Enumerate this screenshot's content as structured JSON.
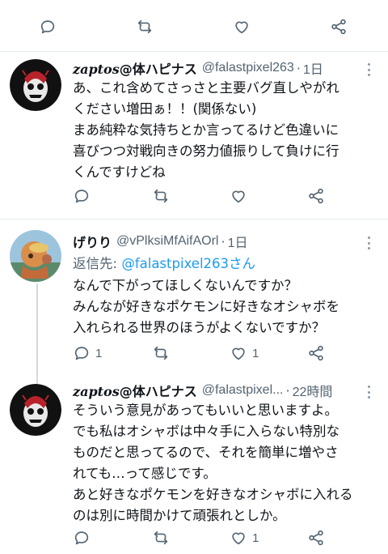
{
  "top_actions": {
    "reply_count": "",
    "retweet_count": "",
    "like_count": ""
  },
  "tweets": [
    {
      "display_name_latin": "zaptos",
      "display_name_rest": "@体ハピナス",
      "handle": "@falastpixel263",
      "dot": "·",
      "time": "1日",
      "lines": [
        "あ、これ含めてさっさと主要バグ直しやがれ",
        "ください増田ぁ！！(関係ない)",
        "まあ純粋な気持ちとか言ってるけど色違いに",
        "喜びつつ対戦向きの努力値振りして負けに行",
        "くんですけどね"
      ],
      "reply_count": "",
      "retweet_count": "",
      "like_count": ""
    },
    {
      "display_name_latin": "",
      "display_name_rest": "げりり",
      "handle": "@vPlksiMfAifAOrl",
      "dot": "·",
      "time": "1日",
      "reply_prefix": "返信先: ",
      "reply_mention": "@falastpixel263さん",
      "lines": [
        "なんで下がってほしくないんですか？",
        "みんなが好きなポケモンに好きなオシャボを",
        "入れられる世界のほうがよくないですか？"
      ],
      "reply_count": "1",
      "retweet_count": "",
      "like_count": "1"
    },
    {
      "display_name_latin": "zaptos",
      "display_name_rest": "@体ハピナス",
      "handle": "@falastpixel...",
      "dot": "·",
      "time": "22時間",
      "lines": [
        "そういう意見があってもいいと思いますよ。",
        "でも私はオシャボは中々手に入らない特別な",
        "ものだと思ってるので、それを簡単に増やさ",
        "れても…って感じです。",
        "あと好きなポケモンを好きなオシャボに入れる",
        "のは別に時間かけて頑張れとしか。"
      ],
      "reply_count": "",
      "retweet_count": "",
      "like_count": "1"
    }
  ],
  "colors": {
    "icon_gray": "#536471",
    "mention_blue": "#1d9bf0",
    "divider": "#e6ecf0",
    "thread_line": "#cfd9de"
  },
  "icons": [
    "reply-icon",
    "retweet-icon",
    "like-icon",
    "share-icon",
    "more-icon"
  ]
}
